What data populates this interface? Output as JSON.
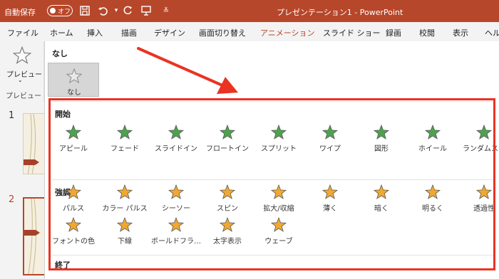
{
  "titlebar": {
    "autosave_label": "自動保存",
    "toggle_label": "オフ",
    "window_title": "プレゼンテーション1 - PowerPoint"
  },
  "ribbon_tabs": [
    "ファイル",
    "ホーム",
    "挿入",
    "描画",
    "デザイン",
    "画面切り替え",
    "アニメーション",
    "スライド ショー",
    "録画",
    "校閲",
    "表示",
    "ヘル"
  ],
  "active_tab_index": 6,
  "preview": {
    "button_label": "プレビュー",
    "group_label": "プレビュー"
  },
  "slides": {
    "numbers": [
      "1",
      "2"
    ],
    "selected_index": 1
  },
  "gallery": {
    "none_section": {
      "heading": "なし",
      "item_label": "なし"
    },
    "entrance": {
      "heading": "開始",
      "color": "#4ea24e",
      "items": [
        "アピール",
        "フェード",
        "スライドイン",
        "フロートイン",
        "スプリット",
        "ワイプ",
        "図形",
        "ホイール",
        "ランダムスト"
      ]
    },
    "emphasis": {
      "heading": "強調",
      "color": "#f0a830",
      "row1": [
        "パルス",
        "カラー パルス",
        "シーソー",
        "スピン",
        "拡大/収縮",
        "薄く",
        "暗く",
        "明るく",
        "透過性"
      ],
      "row2": [
        "フォントの色",
        "下線",
        "ボールドフラ…",
        "太字表示",
        "ウェーブ"
      ]
    },
    "exit": {
      "heading": "終了"
    }
  },
  "colors": {
    "titlebar": "#b7472a",
    "highlight": "#ea3323"
  }
}
